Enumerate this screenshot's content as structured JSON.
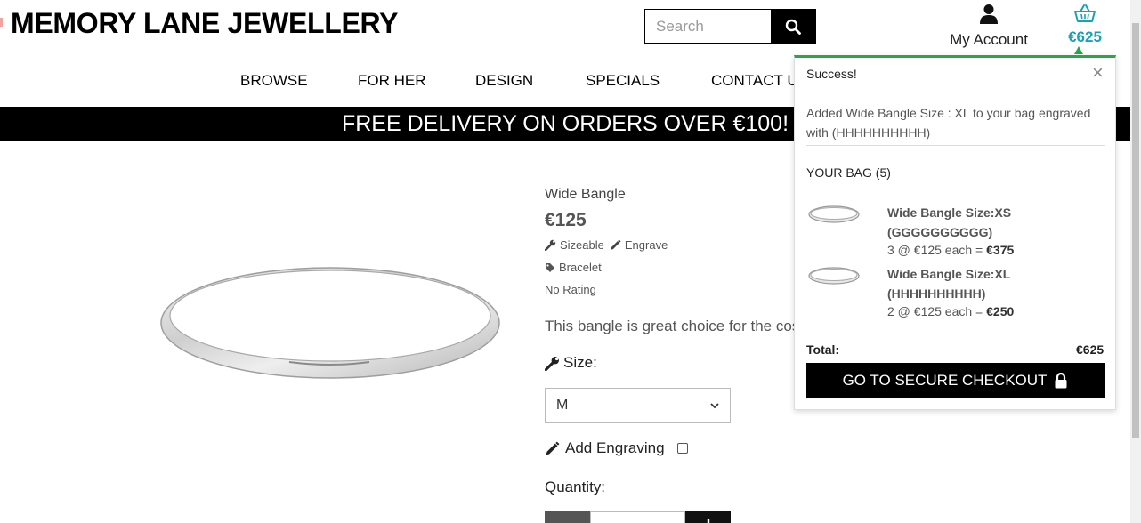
{
  "header": {
    "logo_text": "MEMORY LANE JEWELLERY",
    "search_placeholder": "Search",
    "search_value": "",
    "account_label": "My Account",
    "cart_total": "€625",
    "accent_color": "#17a2b8"
  },
  "nav": {
    "items": [
      "BROWSE",
      "FOR HER",
      "DESIGN",
      "SPECIALS",
      "CONTACT US"
    ]
  },
  "banner": {
    "text": "FREE DELIVERY ON ORDERS OVER €100!"
  },
  "product": {
    "name": "Wide Bangle",
    "price": "€125",
    "feature_sizeable": "Sizeable",
    "feature_engrave": "Engrave",
    "category": "Bracelet",
    "rating": "No Rating",
    "description": "This bangle is great choice for the cos",
    "size_label": "Size:",
    "size_selected": "M",
    "engraving_label": "Add Engraving",
    "engraving_checked": false,
    "quantity_label": "Quantity:"
  },
  "popup": {
    "title": "Success!",
    "close_symbol": "×",
    "message": "Added Wide Bangle Size : XL to your bag engraved with (HHHHHHHHHH)",
    "bag_title": "YOUR BAG (5)",
    "items": [
      {
        "name": "Wide Bangle Size:XS (GGGGGGGGGG)",
        "qty_text": "3 @ €125 each = ",
        "subtotal": "€375"
      },
      {
        "name": "Wide Bangle Size:XL (HHHHHHHHHH)",
        "qty_text": "2 @ €125 each = ",
        "subtotal": "€250"
      }
    ],
    "total_label": "Total:",
    "total_value": "€625",
    "checkout_label": "GO TO SECURE CHECKOUT",
    "accent_color": "#28a745"
  }
}
